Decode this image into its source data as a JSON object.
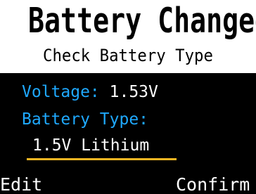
{
  "header": {
    "title": "Battery Changed",
    "subtitle": "Check Battery Type"
  },
  "info": {
    "voltage_label": "Voltage:",
    "voltage_value": "1.53V",
    "battery_type_label": "Battery Type:",
    "battery_type_value": "1.5V Lithium"
  },
  "softkeys": {
    "left": "Edit",
    "right": "Confirm"
  },
  "colors": {
    "background": "#000000",
    "header_background": "#ffffff",
    "label": "#1fa9ff",
    "value": "#ffffff",
    "selection_underline": "#f5b623"
  }
}
